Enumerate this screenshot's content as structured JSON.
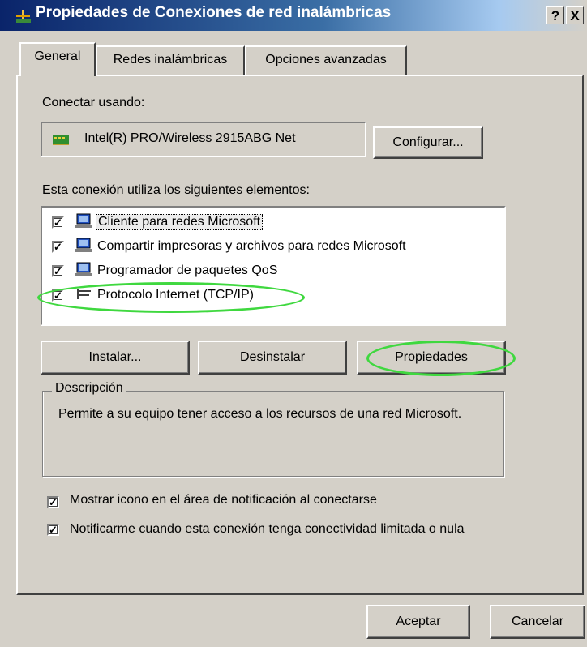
{
  "window": {
    "title": "Propiedades de Conexiones de red inalámbricas",
    "help_button": "?",
    "close_button": "X"
  },
  "tabs": [
    {
      "label": "General",
      "active": true
    },
    {
      "label": "Redes inalámbricas",
      "active": false
    },
    {
      "label": "Opciones avanzadas",
      "active": false
    }
  ],
  "connect_using": {
    "label": "Conectar usando:",
    "adapter": "Intel(R) PRO/Wireless 2915ABG Net",
    "configure_button": "Configurar..."
  },
  "components": {
    "label": "Esta conexión utiliza los siguientes elementos:",
    "items": [
      {
        "label": "Cliente para redes Microsoft",
        "checked": true,
        "icon": "network-client-icon"
      },
      {
        "label": "Compartir impresoras y archivos para redes Microsoft",
        "checked": true,
        "icon": "file-printer-sharing-icon"
      },
      {
        "label": "Programador de paquetes QoS",
        "checked": true,
        "icon": "qos-scheduler-icon"
      },
      {
        "label": "Protocolo Internet (TCP/IP)",
        "checked": true,
        "icon": "protocol-icon"
      }
    ]
  },
  "actions": {
    "install": "Instalar...",
    "uninstall": "Desinstalar",
    "properties": "Propiedades"
  },
  "description": {
    "legend": "Descripción",
    "text": "Permite a su equipo tener acceso a los recursos de una red Microsoft."
  },
  "options": {
    "show_icon": {
      "label": "Mostrar icono en el área de notificación al conectarse",
      "checked": true
    },
    "notify_limited": {
      "label": "Notificarme cuando esta conexión tenga conectividad limitada o nula",
      "checked": true
    }
  },
  "footer": {
    "ok": "Aceptar",
    "cancel": "Cancelar"
  },
  "colors": {
    "highlight_ellipse": "#3fd83f",
    "titlebar": "#0a246a",
    "face": "#d4d0c8"
  }
}
